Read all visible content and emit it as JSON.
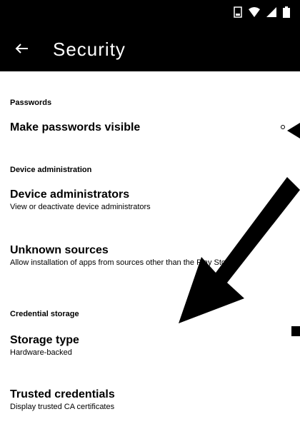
{
  "app": {
    "title": "Security"
  },
  "sections": {
    "passwords": "Passwords",
    "device_admin": "Device administration",
    "credential": "Credential storage"
  },
  "items": {
    "make_visible": {
      "title": "Make passwords visible"
    },
    "device_admins": {
      "title": "Device administrators",
      "summary": "View or deactivate device administrators"
    },
    "unknown_sources": {
      "title": "Unknown sources",
      "summary": "Allow installation of apps from sources other than the Play Store"
    },
    "storage_type": {
      "title": "Storage type",
      "summary": "Hardware-backed"
    },
    "trusted": {
      "title": "Trusted credentials",
      "summary": "Display trusted CA certificates"
    }
  },
  "colors": {
    "bar": "#000000",
    "background": "#ffffff",
    "text": "#000000"
  },
  "icons": [
    "notification-icon",
    "wifi-icon",
    "signal-icon",
    "battery-icon",
    "back-arrow-icon",
    "annotation-arrow"
  ]
}
